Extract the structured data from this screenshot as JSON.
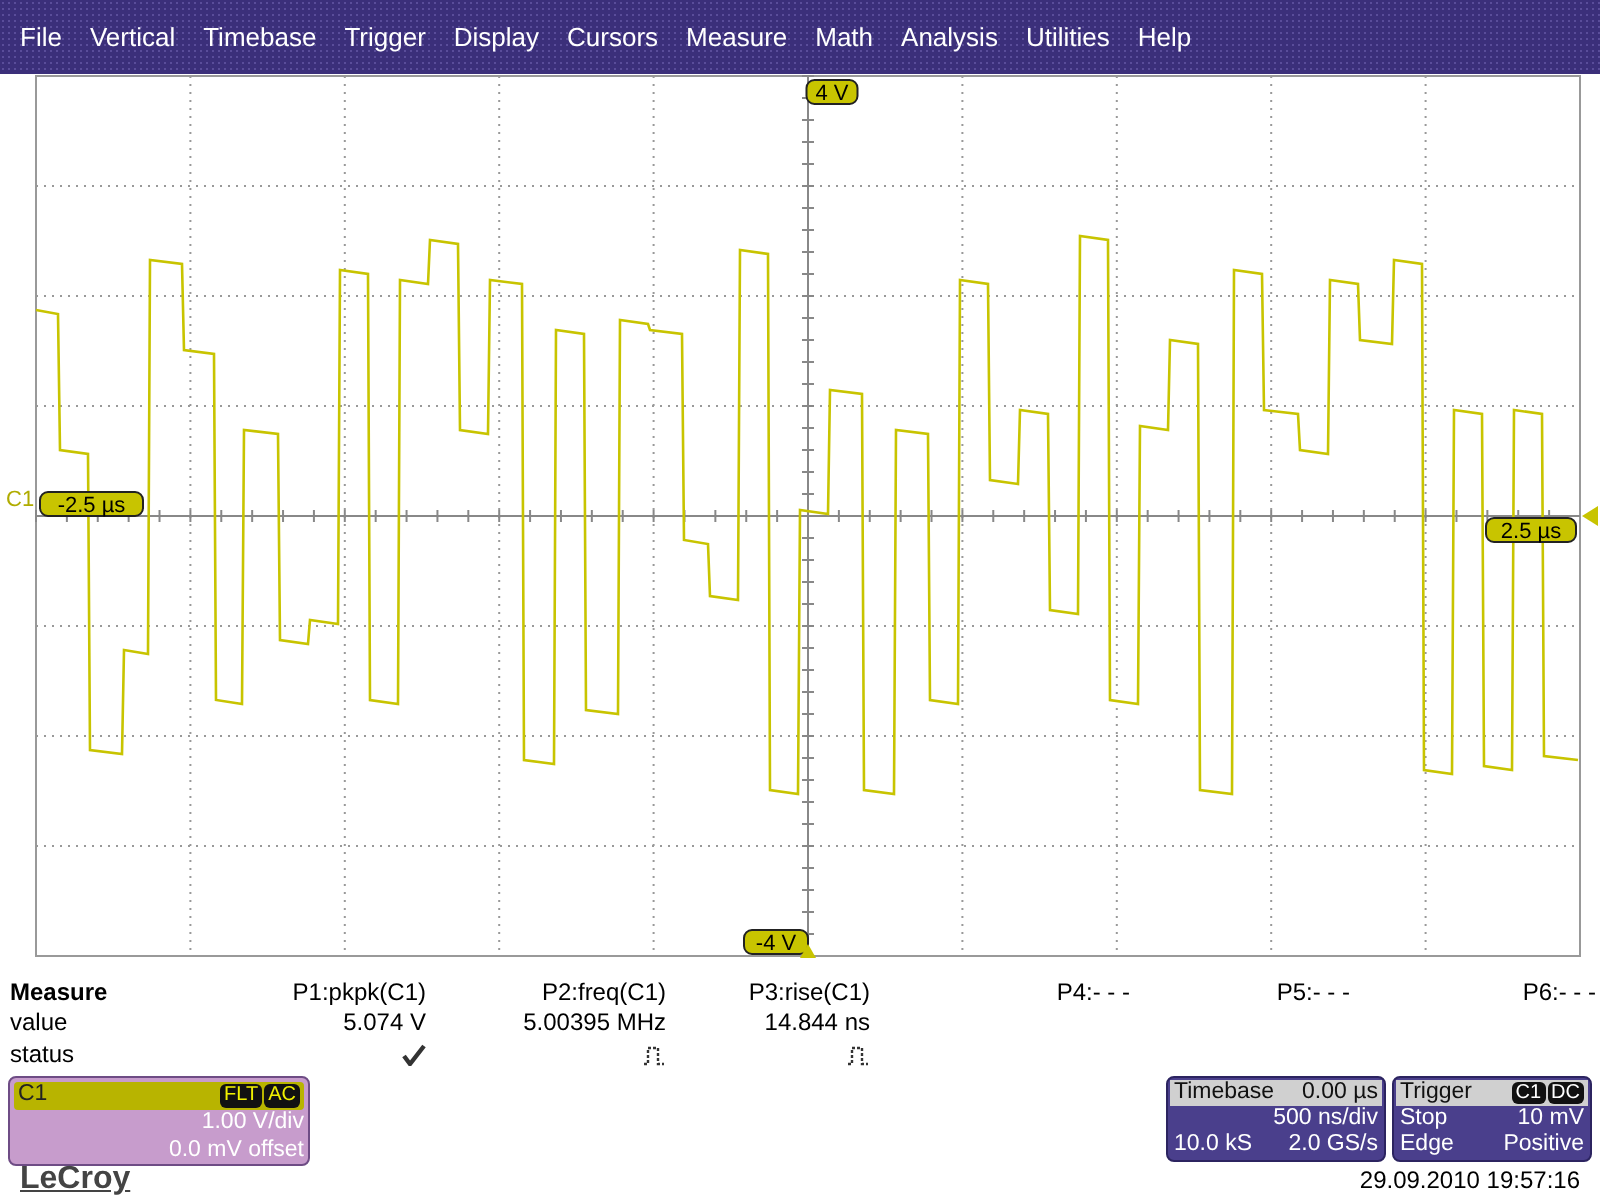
{
  "menu": [
    "File",
    "Vertical",
    "Timebase",
    "Trigger",
    "Display",
    "Cursors",
    "Measure",
    "Math",
    "Analysis",
    "Utilities",
    "Help"
  ],
  "graticule": {
    "top_label": "4 V",
    "bottom_label": "-4 V",
    "left_label": "-2.5 µs",
    "right_label": "2.5 µs",
    "channel_label": "C1"
  },
  "measure": {
    "title": "Measure",
    "row_labels": [
      "value",
      "status"
    ],
    "params": [
      {
        "header": "P1:pkpk(C1)",
        "value": "5.074 V",
        "kind": "check"
      },
      {
        "header": "P2:freq(C1)",
        "value": "5.00395 MHz",
        "kind": "pulse"
      },
      {
        "header": "P3:rise(C1)",
        "value": "14.844 ns",
        "kind": "pulse"
      },
      {
        "header": "P4:- - -"
      },
      {
        "header": "P5:- - -"
      },
      {
        "header": "P6:- - -"
      }
    ]
  },
  "channel": {
    "name": "C1",
    "badges": [
      "FLT",
      "AC"
    ],
    "scale": "1.00 V/div",
    "offset": "0.0 mV offset"
  },
  "timebase": {
    "title": "Timebase",
    "delay": "0.00 µs",
    "rate": "500 ns/div",
    "samples": "10.0 kS",
    "sample_rate": "2.0 GS/s"
  },
  "trigger": {
    "title": "Trigger",
    "badges": [
      "C1",
      "DC"
    ],
    "mode": "Stop",
    "level": "10 mV",
    "type": "Edge",
    "slope": "Positive"
  },
  "logo": "LeCroy",
  "timestamp": "29.09.2010 19:57:16"
}
